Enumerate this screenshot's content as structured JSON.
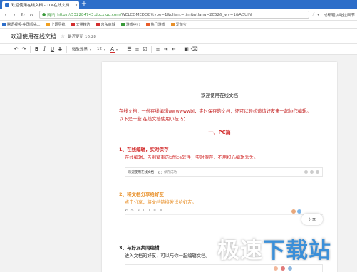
{
  "browser": {
    "tab_title": "欢迎使用在线文档 - TIM在线文档",
    "tab_close": "×",
    "new_tab": "+",
    "nav_back": "‹",
    "nav_forward": "›",
    "nav_reload": "↻",
    "nav_home": "⌂",
    "secure_label": "腾讯",
    "url_host": "https://532284743.docx.qq.com/",
    "url_rest": "WELCOMEDOC?type=1&client=tim&ptlang=2052&_wv=1&ADUIN",
    "search_hint": "成都鞋坊吃拉面节"
  },
  "bookmarks": [
    {
      "label": "腾讯视频-中国领先...",
      "color": "#2d6ec9"
    },
    {
      "label": "上网导航",
      "color": "#f0a020"
    },
    {
      "label": "天猫精选",
      "color": "#d32f2f"
    },
    {
      "label": "京东商城",
      "color": "#d32f2f"
    },
    {
      "label": "游戏中心",
      "color": "#3a9a3a"
    },
    {
      "label": "热门游戏",
      "color": "#e85d2a"
    },
    {
      "label": "爱淘宝",
      "color": "#e8902a"
    }
  ],
  "header": {
    "doc_title": "欢迎使用在线文档",
    "star_icon": "☆",
    "last_update": "最近更新 16:28"
  },
  "toolbar": {
    "undo": "↶",
    "redo": "↷",
    "bold": "B",
    "italic": "I",
    "underline": "U",
    "strike": "S",
    "font_family": "微软雅黑",
    "font_size": "12",
    "text_color": "A",
    "caret": "▾"
  },
  "page": {
    "heading": "欢迎使用在线文档",
    "intro_line1": "在线文档，一份在线编辑wwwwwwbl，实时保存的文档，还可以轻松邀请好友来一起协作编辑。",
    "intro_line2": "以下是一些 在线文档使用小技巧：",
    "section_title": "一、PC篇",
    "item1_title": "1、在线编辑，实时保存",
    "item1_body": "在线编辑，告别繁重的office软件；实时保存，不用担心编辑丢失。",
    "demo1_title": "欢迎使用在线文档",
    "demo1_saved": "保存成功",
    "item2_title": "2、将文档分享给好友",
    "item2_body": "点击分享，将文档链接发送给好友。",
    "share_label": "分享",
    "item3_title": "3、与好友共同编辑",
    "item3_body": "进入文档的好友，可以与你一起编辑文档。"
  },
  "watermark": {
    "text_part1": "极速",
    "text_part2": "下载站"
  }
}
